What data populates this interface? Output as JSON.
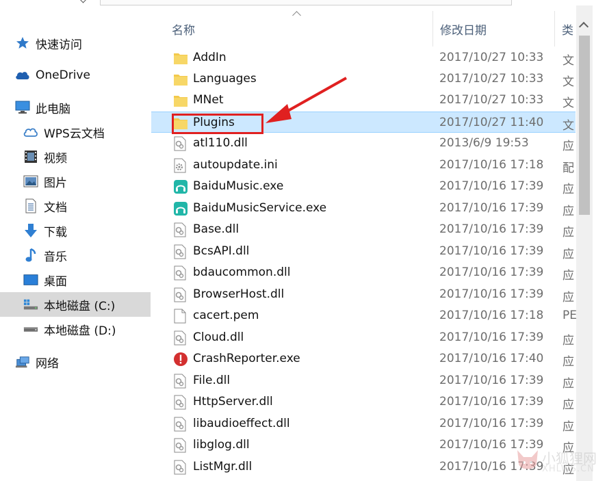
{
  "nav": {
    "items": [
      {
        "label": "快速访问",
        "icon": "star-icon"
      },
      {
        "label": "OneDrive",
        "icon": "cloud-icon"
      },
      {
        "label": "此电脑",
        "icon": "monitor-icon"
      },
      {
        "label": "WPS云文档",
        "icon": "cloud-outline-icon"
      },
      {
        "label": "视频",
        "icon": "film-icon"
      },
      {
        "label": "图片",
        "icon": "picture-icon"
      },
      {
        "label": "文档",
        "icon": "document-icon"
      },
      {
        "label": "下载",
        "icon": "download-arrow-icon"
      },
      {
        "label": "音乐",
        "icon": "music-note-icon"
      },
      {
        "label": "桌面",
        "icon": "desktop-icon"
      },
      {
        "label": "本地磁盘 (C:)",
        "icon": "drive-c-icon",
        "selected": true
      },
      {
        "label": "本地磁盘 (D:)",
        "icon": "drive-icon"
      },
      {
        "label": "网络",
        "icon": "network-icon"
      }
    ]
  },
  "columns": {
    "name": "名称",
    "date": "修改日期",
    "type": "类"
  },
  "files": [
    {
      "name": "AddIn",
      "date": "2017/10/27 10:33",
      "type": "文",
      "icon": "folder"
    },
    {
      "name": "Languages",
      "date": "2017/10/27 10:33",
      "type": "文",
      "icon": "folder"
    },
    {
      "name": "MNet",
      "date": "2017/10/27 10:33",
      "type": "文",
      "icon": "folder"
    },
    {
      "name": "Plugins",
      "date": "2017/10/27 11:40",
      "type": "文",
      "icon": "folder",
      "selected": true
    },
    {
      "name": "atl110.dll",
      "date": "2013/6/9 19:53",
      "type": "应",
      "icon": "dll"
    },
    {
      "name": "autoupdate.ini",
      "date": "2017/10/16 17:18",
      "type": "配",
      "icon": "ini"
    },
    {
      "name": "BaiduMusic.exe",
      "date": "2017/10/16 17:39",
      "type": "应",
      "icon": "music-app"
    },
    {
      "name": "BaiduMusicService.exe",
      "date": "2017/10/16 17:39",
      "type": "应",
      "icon": "music-app"
    },
    {
      "name": "Base.dll",
      "date": "2017/10/16 17:39",
      "type": "应",
      "icon": "dll"
    },
    {
      "name": "BcsAPI.dll",
      "date": "2017/10/16 17:39",
      "type": "应",
      "icon": "dll"
    },
    {
      "name": "bdaucommon.dll",
      "date": "2017/10/16 17:39",
      "type": "应",
      "icon": "dll"
    },
    {
      "name": "BrowserHost.dll",
      "date": "2017/10/16 17:39",
      "type": "应",
      "icon": "dll"
    },
    {
      "name": "cacert.pem",
      "date": "2017/10/16 17:18",
      "type": "PE",
      "icon": "blank"
    },
    {
      "name": "Cloud.dll",
      "date": "2017/10/16 17:39",
      "type": "应",
      "icon": "dll"
    },
    {
      "name": "CrashReporter.exe",
      "date": "2017/10/16 17:40",
      "type": "应",
      "icon": "error"
    },
    {
      "name": "File.dll",
      "date": "2017/10/16 17:39",
      "type": "应",
      "icon": "dll"
    },
    {
      "name": "HttpServer.dll",
      "date": "2017/10/16 17:39",
      "type": "应",
      "icon": "dll"
    },
    {
      "name": "libaudioeffect.dll",
      "date": "2017/10/16 17:39",
      "type": "应",
      "icon": "dll"
    },
    {
      "name": "libglog.dll",
      "date": "2017/10/16 17:39",
      "type": "应",
      "icon": "dll"
    },
    {
      "name": "ListMgr.dll",
      "date": "2017/10/16 17:39",
      "type": "应",
      "icon": "dll"
    }
  ],
  "watermark": {
    "name": "小狐狸网",
    "url": "XHLWS.CN"
  },
  "colors": {
    "selected_row": "#cce8ff",
    "annotation": "#e02020",
    "folder": "#f3c94b"
  }
}
